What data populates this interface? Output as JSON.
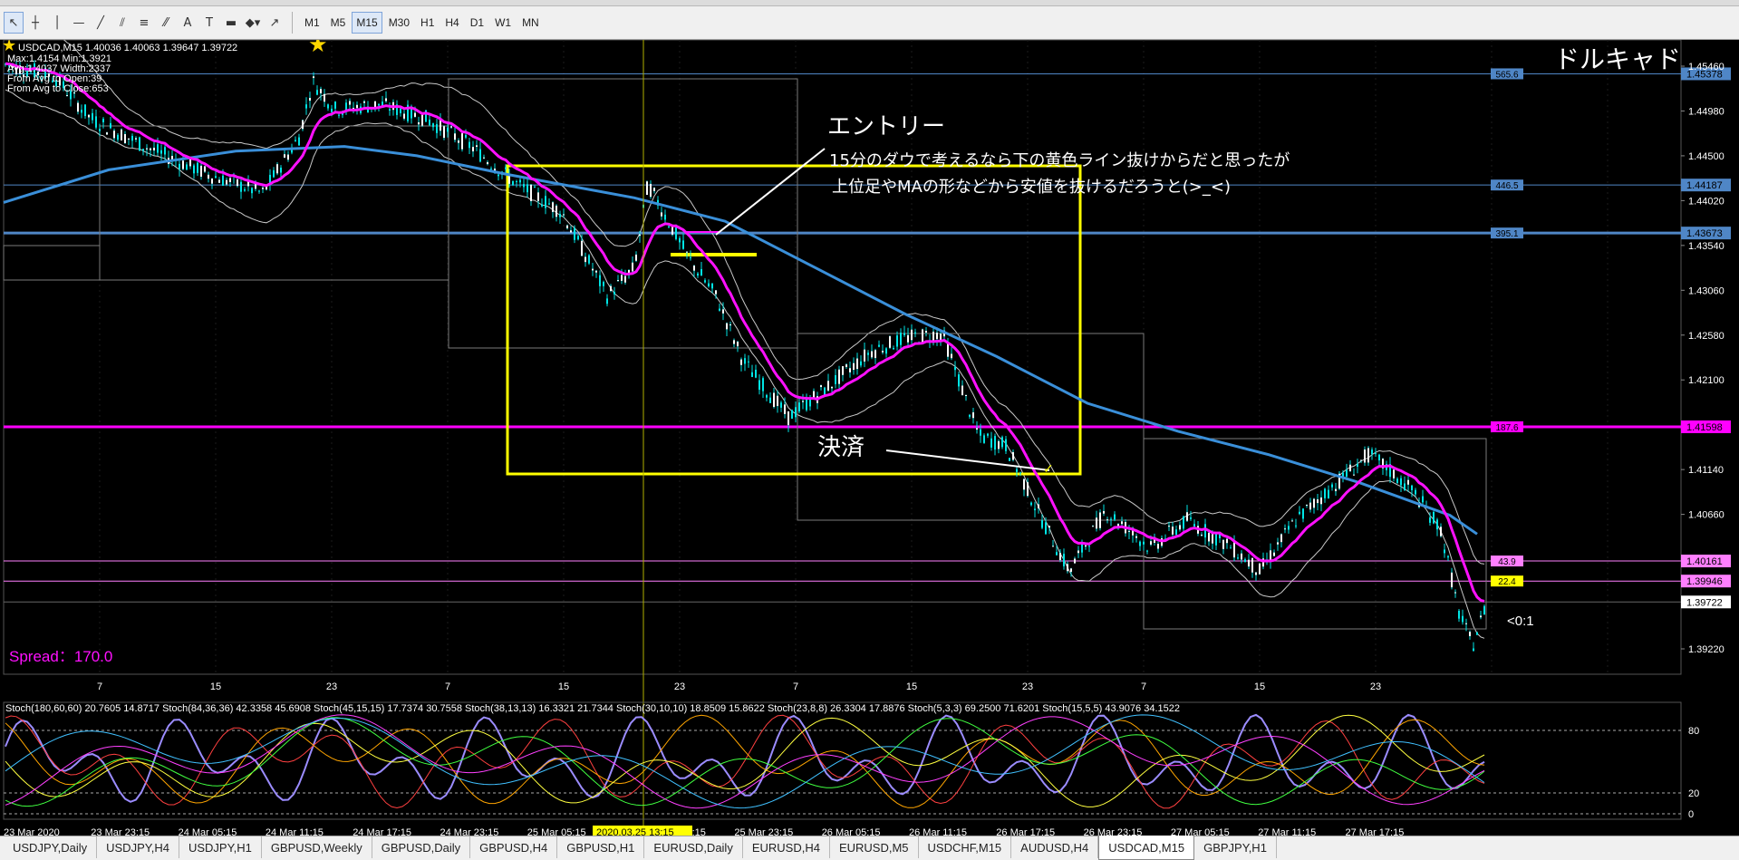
{
  "toolbar": {
    "tools": [
      {
        "name": "cursor-icon",
        "glyph": "↖",
        "active": true
      },
      {
        "name": "crosshair-icon",
        "glyph": "┼"
      },
      {
        "name": "vertical-line-icon",
        "glyph": "│"
      },
      {
        "name": "horizontal-line-icon",
        "glyph": "—"
      },
      {
        "name": "trendline-icon",
        "glyph": "╱"
      },
      {
        "name": "channel-icon",
        "glyph": "⫽"
      },
      {
        "name": "fibonacci-icon",
        "glyph": "≡"
      },
      {
        "name": "gann-icon",
        "glyph": "⁄⁄"
      },
      {
        "name": "text-icon",
        "glyph": "A"
      },
      {
        "name": "text-label-icon",
        "glyph": "T"
      },
      {
        "name": "rectangle-icon",
        "glyph": "▬"
      },
      {
        "name": "shapes-icon",
        "glyph": "◆▾"
      },
      {
        "name": "arrow-icon",
        "glyph": "↗"
      }
    ],
    "timeframes": [
      {
        "label": "M1"
      },
      {
        "label": "M5"
      },
      {
        "label": "M15",
        "active": true
      },
      {
        "label": "M30"
      },
      {
        "label": "H1"
      },
      {
        "label": "H4"
      },
      {
        "label": "D1"
      },
      {
        "label": "W1"
      },
      {
        "label": "MN"
      }
    ]
  },
  "chart": {
    "header": "USDCAD,M15  1.40036 1.40063 1.39647 1.39722",
    "stats": [
      "Max:1.4154 Min:1.3921",
      "Avg:1.4037 Width:2337",
      "From Avg to Open:39",
      "From Avg to Close:653"
    ],
    "title_jp": "ドルキャド",
    "spread": "Spread：170.0",
    "ratio": "<0:1",
    "annotations": {
      "entry": "エントリー",
      "entry_note1": "15分のダウで考えるなら下の黄色ライン抜けからだと思ったが",
      "entry_note2": "上位足やMAの形などから安値を抜けるだろうと(>_<)",
      "exit": "決済"
    },
    "price_ticks": [
      "1.45460",
      "1.44980",
      "1.44500",
      "1.44020",
      "1.43540",
      "1.43060",
      "1.42580",
      "1.42100",
      "1.41140",
      "1.40660",
      "1.39220"
    ],
    "price_levels": [
      {
        "price": "1.45378",
        "label": "565.6",
        "color": "#4f86c6",
        "width": 1
      },
      {
        "price": "1.44187",
        "label": "446.5",
        "color": "#4f86c6",
        "width": 1
      },
      {
        "price": "1.43673",
        "label": "395.1",
        "color": "#4f86c6",
        "width": 3
      },
      {
        "price": "1.41598",
        "label": "187.6",
        "color": "#ff00ff",
        "width": 3
      },
      {
        "price": "1.40161",
        "label": "43.9",
        "color": "#ff7fff",
        "width": 1
      },
      {
        "price": "1.39946",
        "label": "22.4",
        "color": "#ff7fff",
        "width": 1
      }
    ],
    "current_price": "1.39722",
    "time_ticks": [
      "7",
      "15",
      "23",
      "7",
      "15",
      "23",
      "7",
      "15",
      "23",
      "7",
      "15",
      "23"
    ],
    "stoch_label": "Stoch(180,60,60) 20.7605 14.8717  Stoch(84,36,36) 42.3358 45.6908  Stoch(45,15,15) 17.7374 30.7558  Stoch(38,13,13) 16.3321 21.7344  Stoch(30,10,10) 18.8509 15.8622  Stoch(23,8,8) 26.3304 17.8876  Stoch(5,3,3) 69.2500 71.6201  Stoch(15,5,5) 43.9076 34.1522",
    "stoch_levels": [
      "80",
      "20",
      "0"
    ],
    "date_ticks": [
      "23 Mar 2020",
      "23 Mar 23:15",
      "24 Mar 05:15",
      "24 Mar 11:15",
      "24 Mar 17:15",
      "24 Mar 23:15",
      "25 Mar 05:15",
      "25 Mar 17:15",
      "25 Mar 23:15",
      "26 Mar 05:15",
      "26 Mar 11:15",
      "26 Mar 17:15",
      "26 Mar 23:15",
      "27 Mar 05:15",
      "27 Mar 11:15",
      "27 Mar 17:15"
    ],
    "cursor_date": "2020.03.25 13:15",
    "colors": {
      "bull": "#00e5e5",
      "bear": "#00e5e5",
      "ma_fast": "#ff10ff",
      "ma_slow": "#3a8fd9",
      "bb": "#c8c8c8",
      "box": "#ffff00",
      "text": "#ffffff"
    }
  },
  "tabs": [
    {
      "label": "USDJPY,Daily"
    },
    {
      "label": "USDJPY,H4"
    },
    {
      "label": "USDJPY,H1"
    },
    {
      "label": "GBPUSD,Weekly"
    },
    {
      "label": "GBPUSD,Daily"
    },
    {
      "label": "GBPUSD,H4"
    },
    {
      "label": "GBPUSD,H1"
    },
    {
      "label": "EURUSD,Daily"
    },
    {
      "label": "EURUSD,H4"
    },
    {
      "label": "EURUSD,M5"
    },
    {
      "label": "USDCHF,M15"
    },
    {
      "label": "AUDUSD,H4"
    },
    {
      "label": "USDCAD,M15",
      "active": true
    },
    {
      "label": "GBPJPY,H1"
    }
  ]
}
